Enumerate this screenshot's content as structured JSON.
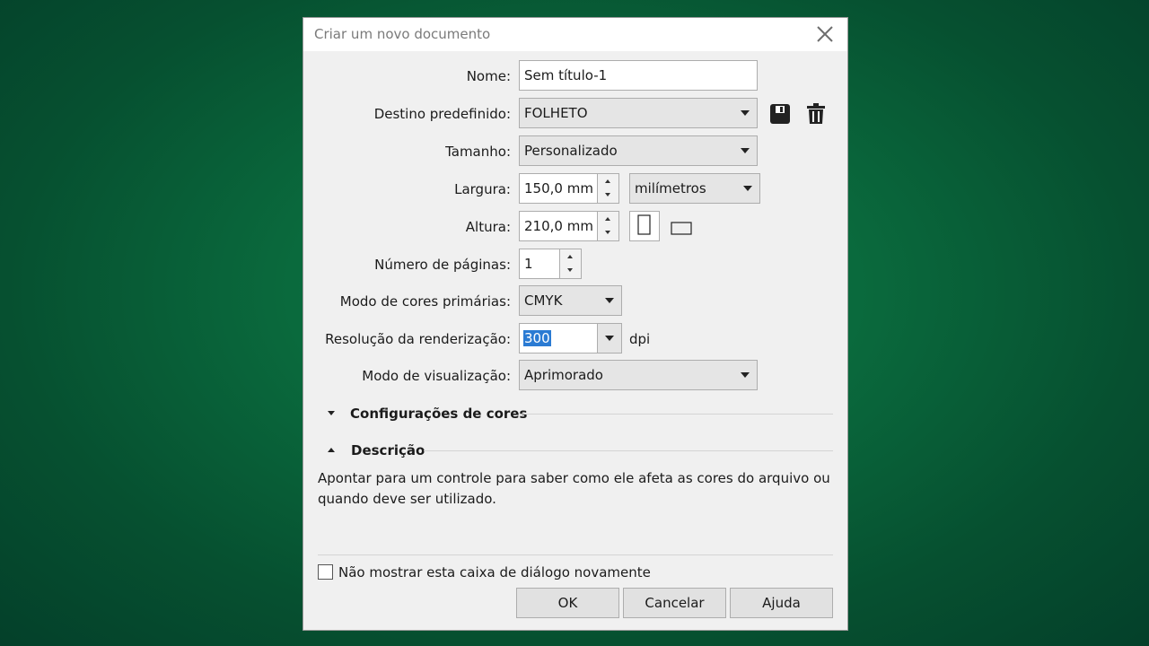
{
  "dialog": {
    "title": "Criar um novo documento",
    "fields": {
      "name": {
        "label": "Nome:",
        "value": "Sem título-1"
      },
      "preset": {
        "label": "Destino predefinido:",
        "value": "FOLHETO"
      },
      "size": {
        "label": "Tamanho:",
        "value": "Personalizado"
      },
      "width": {
        "label": "Largura:",
        "value": "150,0 mm",
        "unit": "milímetros"
      },
      "height": {
        "label": "Altura:",
        "value": "210,0 mm"
      },
      "pages": {
        "label": "Número de páginas:",
        "value": "1"
      },
      "color_mode": {
        "label": "Modo de cores primárias:",
        "value": "CMYK"
      },
      "resolution": {
        "label": "Resolução da renderização:",
        "value": "300",
        "unit": "dpi"
      },
      "preview_mode": {
        "label": "Modo de visualização:",
        "value": "Aprimorado"
      }
    },
    "sections": {
      "color_settings": "Configurações de cores",
      "description": "Descrição"
    },
    "description_text": "Apontar para um controle para saber como ele afeta as cores do arquivo ou quando deve ser utilizado.",
    "checkbox": {
      "label": "Não mostrar esta caixa de diálogo novamente",
      "checked": false
    },
    "buttons": {
      "ok": "OK",
      "cancel": "Cancelar",
      "help": "Ajuda"
    }
  },
  "icons": [
    "close-icon",
    "save-preset-icon",
    "delete-preset-icon",
    "portrait-orientation-icon",
    "landscape-orientation-icon",
    "expand-arrow-icon",
    "collapse-arrow-icon"
  ],
  "colors": {
    "background": "#0a6a3d",
    "dialog": "#f0f0f0",
    "selection": "#2b7bd3"
  }
}
